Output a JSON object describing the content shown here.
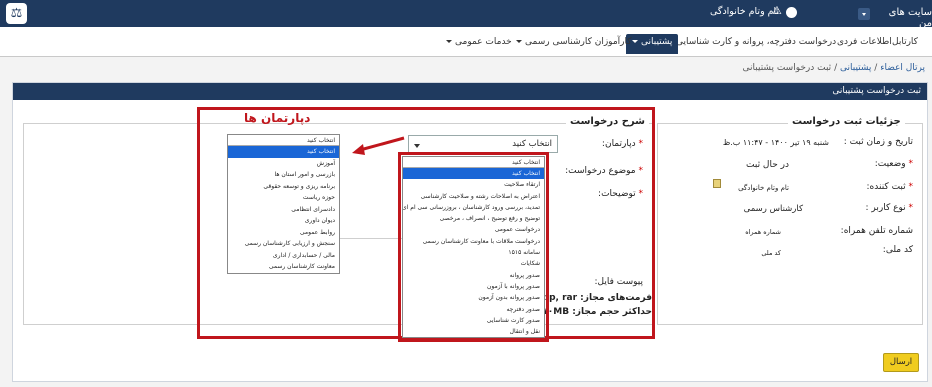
{
  "topbar": {
    "site_label": "سایت های من",
    "username": "تام وتام خانوادگی",
    "logo_icon": "scales-icon"
  },
  "nav": {
    "tabs": [
      {
        "label": "کارتابل"
      },
      {
        "label": "اطلاعات فردی"
      },
      {
        "label": "درخواست دفترچه، پروانه و کارت شناسایی"
      },
      {
        "label": "پشتیبانی"
      },
      {
        "label": "کارآموزان کارشناسی رسمی"
      },
      {
        "label": "خدمات عمومی"
      }
    ],
    "active": "پشتیبانی"
  },
  "breadcrumb": {
    "root": "پرتال اعضاء",
    "sep1": "/",
    "mid": "پشتیبانی",
    "sep2": "/",
    "current": "ثبت درخواست پشتیبانی"
  },
  "panel": {
    "title": "ثبت درخواست پشتیبانی",
    "details": {
      "legend": "جزئیات ثبت درخواست",
      "datetime_label": "تاریخ و زمان ثبت :",
      "datetime_value": "شنبه ۱۹ تیر ۱۴۰۰ - ۱۱:۴۷ ب.ظ",
      "status_label": "وضعیت:",
      "status_value": "در حال ثبت",
      "submitter_label": "ثبت کننده:",
      "submitter_value": "تام وتام خانوادگی",
      "usertype_label": "نوع کاربر :",
      "usertype_value": "کارشناس رسمی",
      "phone_label": "شماره تلفن همراه:",
      "phone_value": "شماره همراه",
      "nid_label": "کد ملی:",
      "nid_value": "کد ملی",
      "required_mark": "*"
    },
    "request": {
      "legend": "شرح درخواست",
      "department_label": "دپارتمان:",
      "department_value": "انتخاب کنید",
      "subject_label": "موضوع درخواست:",
      "subject_value": "انتخاب کنید",
      "desc_label": "توضیحات:",
      "attach_label": "پیوست فایل:",
      "formats_label": "فرمت‌های مجاز: zip, rar",
      "maxsize_label": "حداکثر حجم مجاز: ۱۰MB",
      "required_mark": "*"
    },
    "submit_label": "ارسال"
  },
  "annotation": {
    "title": "دپارتمان ها"
  },
  "department_dropdown": {
    "current": "انتخاب کنید",
    "options": [
      "انتخاب کنید",
      "آموزش",
      "بازرسی و امور استان ها",
      "برنامه ریزی و توسعه حقوقی",
      "حوزه ریاست",
      "دادسرای انتظامی",
      "دیوان داوری",
      "روابط عمومی",
      "سنجش و ارزیابی کارشناسان رسمی",
      "مالی / حسابداری / اداری",
      "معاونت کارشناسان رسمی"
    ]
  },
  "subject_dropdown": {
    "current": "انتخاب کنید",
    "options": [
      "انتخاب کنید",
      "ارتقاء صلاحیت",
      "اعتراض به اصلاحات رشته و صلاحیت کارشناسی",
      "تمدید، بررسی ورود کارشناسان ، بروزرسانی سی ام ای",
      "توضیح و رفع توضیح ، انصراف ، مرخصی",
      "درخواست عمومی",
      "درخواست ملاقات با معاونت کارشناسان رسمی",
      "سامانه ۱۵۱۵",
      "شکایات",
      "صدور پروانه",
      "صدور پروانه با آزمون",
      "صدور پروانه بدون آزمون",
      "صدور دفترچه",
      "صدور کارت شناسایی",
      "نقل و انتقال"
    ]
  },
  "colors": {
    "header": "#1f3a5f",
    "highlight": "#c0161c",
    "selected": "#1a66d6",
    "submit": "#f0cc1f"
  }
}
